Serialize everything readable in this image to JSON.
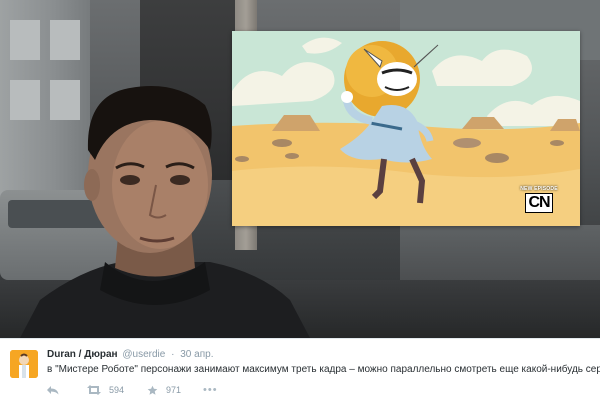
{
  "tweet": {
    "display_name": "Duran / Дюран",
    "handle": "@userdie",
    "separator": "·",
    "date": "30 апр.",
    "text": "в \"Мистере Роботе\" персонажи занимают максимум треть кадра – можно параллельно смотреть еще какой-нибудь сериал",
    "retweet_count": "594",
    "favorite_count": "971",
    "more_glyph": "•••"
  },
  "cartoon": {
    "badge_line1": "NEW EPISODE",
    "badge_logo": "CN"
  },
  "icons": {
    "reply": "reply-icon",
    "retweet": "retweet-icon",
    "favorite": "star-icon",
    "more": "more-icon"
  },
  "colors": {
    "name": "#292f33",
    "meta": "#8899a6",
    "avatar_bg": "#f6a623",
    "sand": "#f2c46c",
    "sky": "#c9e6d6"
  }
}
